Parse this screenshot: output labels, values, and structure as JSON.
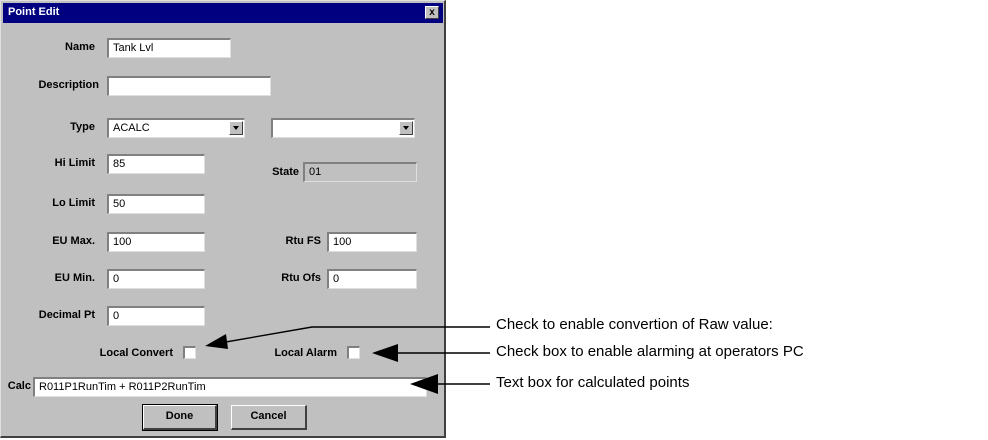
{
  "window": {
    "title": "Point Edit",
    "close_label": "x"
  },
  "fields": {
    "name": {
      "label": "Name",
      "value": "Tank Lvl"
    },
    "description": {
      "label": "Description",
      "value": ""
    },
    "type": {
      "label": "Type",
      "value": "ACALC",
      "second_value": ""
    },
    "hi_limit": {
      "label": "Hi Limit",
      "value": "85"
    },
    "state": {
      "label": "State",
      "value": "01"
    },
    "lo_limit": {
      "label": "Lo Limit",
      "value": "50"
    },
    "eu_max": {
      "label": "EU Max.",
      "value": "100"
    },
    "rtu_fs": {
      "label": "Rtu FS",
      "value": "100"
    },
    "eu_min": {
      "label": "EU Min.",
      "value": "0"
    },
    "rtu_ofs": {
      "label": "Rtu Ofs",
      "value": "0"
    },
    "decimal_pt": {
      "label": "Decimal Pt",
      "value": "0"
    },
    "local_convert": {
      "label": "Local Convert",
      "checked": false
    },
    "local_alarm": {
      "label": "Local Alarm",
      "checked": false
    },
    "calc": {
      "label": "Calc",
      "value": "R011P1RunTim + R011P2RunTim"
    }
  },
  "buttons": {
    "done": "Done",
    "cancel": "Cancel"
  },
  "annotations": [
    "Check to enable convertion of Raw value:",
    "Check box to enable alarming at operators PC",
    "Text box for calculated points"
  ]
}
